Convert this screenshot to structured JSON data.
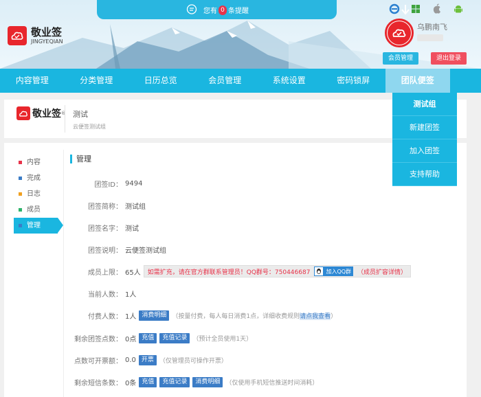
{
  "notice": {
    "prefix": "您有",
    "count": "0",
    "suffix": "条提醒"
  },
  "logo": {
    "cn": "敬业签",
    "en": "JINGYEQIAN"
  },
  "user": {
    "name": "乌鹏南飞",
    "member_btn": "会员管理",
    "logout_btn": "退出登录"
  },
  "platform_icons": [
    "ie-icon",
    "windows-icon",
    "apple-icon",
    "android-icon"
  ],
  "nav": [
    "内容管理",
    "分类管理",
    "日历总览",
    "会员管理",
    "系统设置",
    "密码锁屏",
    "团队便签"
  ],
  "dropdown": [
    "测试组",
    "新建团签",
    "加入团签",
    "支持帮助"
  ],
  "banner": {
    "logo": "敬业签",
    "title": "测试",
    "desc": "云便签测试组"
  },
  "sidenav": [
    {
      "label": "内容",
      "color": "#e8334a"
    },
    {
      "label": "完成",
      "color": "#3b7cc6"
    },
    {
      "label": "日志",
      "color": "#f0a020"
    },
    {
      "label": "成员",
      "color": "#2db46a"
    },
    {
      "label": "管理",
      "color": "#3b7cc6"
    }
  ],
  "section_title": "管理",
  "fields": {
    "id": {
      "label": "团签ID：",
      "value": "9494"
    },
    "short": {
      "label": "团签简称：",
      "value": "测试组"
    },
    "name": {
      "label": "团签名字：",
      "value": "测试"
    },
    "desc": {
      "label": "团签说明：",
      "value": "云便签测试组"
    },
    "limit": {
      "label": "成员上限：",
      "value": "65人",
      "warn": "如需扩充，请在官方群联系管理员！QQ群号：750446687",
      "qq_btn": "加入QQ群",
      "detail": "（成员扩容详情）"
    },
    "current": {
      "label": "当前人数：",
      "value": "1人"
    },
    "paid": {
      "label": "付费人数：",
      "value": "1人",
      "btn": "消费明细",
      "note_a": "（按量付费，每人每日消费1点，详细收费规则",
      "note_link": "请点我查看",
      "note_b": "）"
    },
    "points": {
      "label": "剩余团签点数：",
      "value": "0点",
      "btn1": "充值",
      "btn2": "充值记录",
      "note": "（预计全员使用1天）"
    },
    "invoice": {
      "label": "点数可开票额：",
      "value": "0.0",
      "btn": "开票",
      "note": "（仅管理员可操作开票）"
    },
    "sms": {
      "label": "剩余短信条数：",
      "value": "0条",
      "btn1": "充值",
      "btn2": "充值记录",
      "btn3": "消费明细",
      "note": "（仅使用手机短信推送时间消耗）"
    }
  }
}
